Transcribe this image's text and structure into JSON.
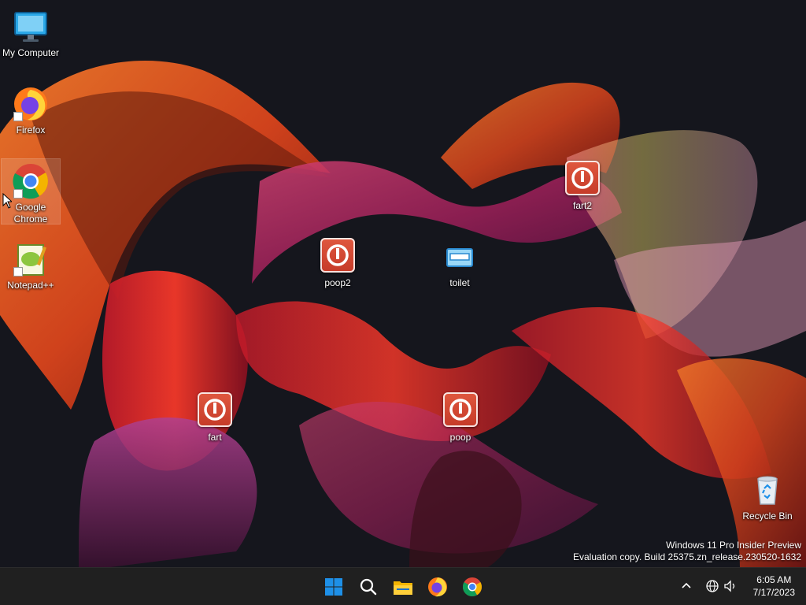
{
  "desktop": {
    "icons": [
      {
        "id": "my-computer",
        "label": "My Computer",
        "icon": "monitor-icon"
      },
      {
        "id": "firefox",
        "label": "Firefox",
        "icon": "firefox-icon"
      },
      {
        "id": "chrome",
        "label": "Google Chrome",
        "icon": "chrome-icon",
        "selected": true
      },
      {
        "id": "notepadpp",
        "label": "Notepad++",
        "icon": "notepad-plus-plus-icon"
      },
      {
        "id": "poop2",
        "label": "poop2",
        "icon": "power-icon"
      },
      {
        "id": "toilet",
        "label": "toilet",
        "icon": "window-app-icon"
      },
      {
        "id": "fart2",
        "label": "fart2",
        "icon": "power-icon"
      },
      {
        "id": "fart",
        "label": "fart",
        "icon": "power-icon"
      },
      {
        "id": "poop",
        "label": "poop",
        "icon": "power-icon"
      },
      {
        "id": "recycle-bin",
        "label": "Recycle Bin",
        "icon": "recycle-bin-icon"
      }
    ]
  },
  "watermark": {
    "line1": "Windows 11 Pro Insider Preview",
    "line2": "Evaluation copy. Build 25375.zn_release.230520-1632"
  },
  "taskbar": {
    "pinned": [
      {
        "name": "start-button",
        "icon": "windows-logo-icon"
      },
      {
        "name": "search-button",
        "icon": "search-icon"
      },
      {
        "name": "file-explorer-button",
        "icon": "folder-icon"
      },
      {
        "name": "firefox-taskbar-button",
        "icon": "firefox-icon"
      },
      {
        "name": "chrome-taskbar-button",
        "icon": "chrome-icon"
      }
    ],
    "tray": {
      "time": "6:05 AM",
      "date": "7/17/2023"
    }
  },
  "colors": {
    "taskbar_bg": "#202020",
    "power_app": "#d9473a",
    "windows_blue": "#1e90e8"
  }
}
